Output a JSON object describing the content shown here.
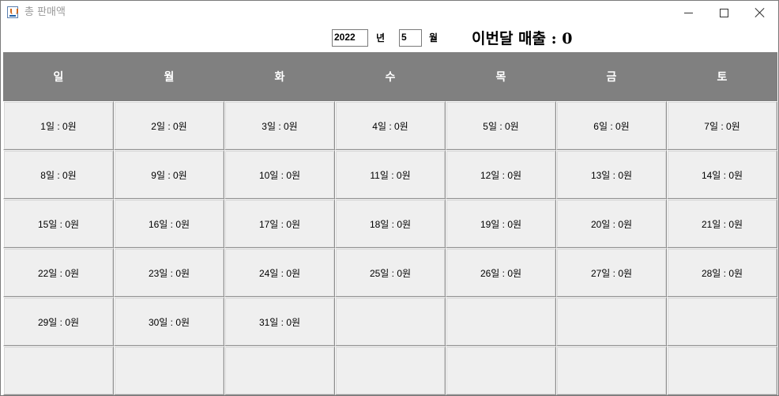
{
  "window": {
    "title": "총 판매액"
  },
  "controls": {
    "year_value": "2022",
    "year_unit": "년",
    "month_value": "5",
    "month_unit": "월",
    "sales_label": "이번달 매출 : 0"
  },
  "calendar": {
    "weekdays": [
      "일",
      "월",
      "화",
      "수",
      "목",
      "금",
      "토"
    ],
    "cells": [
      "1일 : 0원",
      "2일 : 0원",
      "3일 : 0원",
      "4일 : 0원",
      "5일 : 0원",
      "6일 : 0원",
      "7일 : 0원",
      "8일 : 0원",
      "9일 : 0원",
      "10일 : 0원",
      "11일 : 0원",
      "12일 : 0원",
      "13일 : 0원",
      "14일 : 0원",
      "15일 : 0원",
      "16일 : 0원",
      "17일 : 0원",
      "18일 : 0원",
      "19일 : 0원",
      "20일 : 0원",
      "21일 : 0원",
      "22일 : 0원",
      "23일 : 0원",
      "24일 : 0원",
      "25일 : 0원",
      "26일 : 0원",
      "27일 : 0원",
      "28일 : 0원",
      "29일 : 0원",
      "30일 : 0원",
      "31일 : 0원",
      "",
      "",
      "",
      "",
      "",
      "",
      "",
      "",
      "",
      "",
      ""
    ]
  },
  "icons": {
    "app": "java-coffee-cup-icon",
    "minimize": "minimize-icon",
    "maximize": "maximize-icon",
    "close": "close-icon"
  }
}
